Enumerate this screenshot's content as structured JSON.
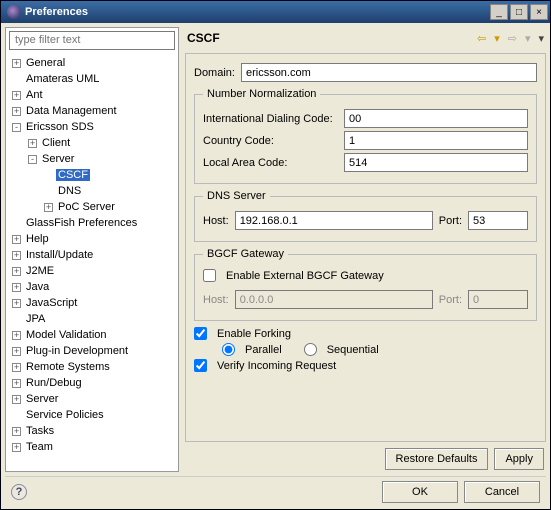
{
  "window": {
    "title": "Preferences"
  },
  "filter": {
    "placeholder": "type filter text"
  },
  "tree": [
    {
      "d": 0,
      "exp": "+",
      "label": "General"
    },
    {
      "d": 0,
      "exp": " ",
      "label": "Amateras UML"
    },
    {
      "d": 0,
      "exp": "+",
      "label": "Ant"
    },
    {
      "d": 0,
      "exp": "+",
      "label": "Data Management"
    },
    {
      "d": 0,
      "exp": "-",
      "label": "Ericsson SDS"
    },
    {
      "d": 1,
      "exp": "+",
      "label": "Client"
    },
    {
      "d": 1,
      "exp": "-",
      "label": "Server"
    },
    {
      "d": 2,
      "exp": " ",
      "label": "CSCF",
      "sel": true
    },
    {
      "d": 2,
      "exp": " ",
      "label": "DNS"
    },
    {
      "d": 2,
      "exp": "+",
      "label": "PoC Server"
    },
    {
      "d": 0,
      "exp": " ",
      "label": "GlassFish Preferences"
    },
    {
      "d": 0,
      "exp": "+",
      "label": "Help"
    },
    {
      "d": 0,
      "exp": "+",
      "label": "Install/Update"
    },
    {
      "d": 0,
      "exp": "+",
      "label": "J2ME"
    },
    {
      "d": 0,
      "exp": "+",
      "label": "Java"
    },
    {
      "d": 0,
      "exp": "+",
      "label": "JavaScript"
    },
    {
      "d": 0,
      "exp": " ",
      "label": "JPA"
    },
    {
      "d": 0,
      "exp": "+",
      "label": "Model Validation"
    },
    {
      "d": 0,
      "exp": "+",
      "label": "Plug-in Development"
    },
    {
      "d": 0,
      "exp": "+",
      "label": "Remote Systems"
    },
    {
      "d": 0,
      "exp": "+",
      "label": "Run/Debug"
    },
    {
      "d": 0,
      "exp": "+",
      "label": "Server"
    },
    {
      "d": 0,
      "exp": " ",
      "label": "Service Policies"
    },
    {
      "d": 0,
      "exp": "+",
      "label": "Tasks"
    },
    {
      "d": 0,
      "exp": "+",
      "label": "Team"
    }
  ],
  "page": {
    "title": "CSCF",
    "domain_label": "Domain:",
    "domain_value": "ericsson.com",
    "nn": {
      "legend": "Number Normalization",
      "idc_label": "International Dialing Code:",
      "idc": "00",
      "cc_label": "Country Code:",
      "cc": "1",
      "lac_label": "Local Area Code:",
      "lac": "514"
    },
    "dns": {
      "legend": "DNS Server",
      "host_label": "Host:",
      "host": "192.168.0.1",
      "port_label": "Port:",
      "port": "53"
    },
    "bgcf": {
      "legend": "BGCF Gateway",
      "enable_label": "Enable External BGCF Gateway",
      "enable": false,
      "host_label": "Host:",
      "host": "0.0.0.0",
      "port_label": "Port:",
      "port": "0"
    },
    "forking": {
      "enable_label": "Enable Forking",
      "enable": true,
      "parallel_label": "Parallel",
      "sequential_label": "Sequential",
      "mode": "parallel"
    },
    "verify_label": "Verify Incoming Request",
    "verify": true,
    "restore": "Restore Defaults",
    "apply": "Apply"
  },
  "buttons": {
    "ok": "OK",
    "cancel": "Cancel"
  }
}
